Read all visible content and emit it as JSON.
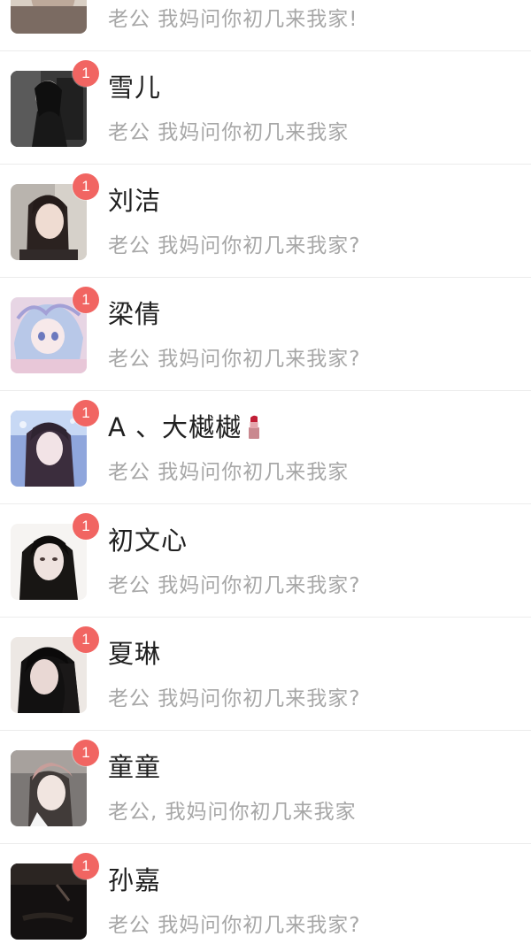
{
  "chats": [
    {
      "name": "",
      "message": "老公 我妈问你初几来我家!",
      "badge": "",
      "avatar": "avatar-partial"
    },
    {
      "name": "雪儿",
      "message": "老公 我妈问你初几来我家",
      "badge": "1",
      "avatar": "avatar-girl-dark"
    },
    {
      "name": "刘洁",
      "message": "老公 我妈问你初几来我家?",
      "badge": "1",
      "avatar": "avatar-girl-portrait"
    },
    {
      "name": "梁倩",
      "message": "老公 我妈问你初几来我家?",
      "badge": "1",
      "avatar": "avatar-anime"
    },
    {
      "name": "A 、大樾樾",
      "message": "老公 我妈问你初几来我家",
      "badge": "1",
      "avatar": "avatar-girl-blue",
      "name_icon": "lipstick-icon"
    },
    {
      "name": "初文心",
      "message": "老公 我妈问你初几来我家?",
      "badge": "1",
      "avatar": "avatar-girl-long-hair"
    },
    {
      "name": "夏琳",
      "message": "老公 我妈问你初几来我家?",
      "badge": "1",
      "avatar": "avatar-girl-black-hair"
    },
    {
      "name": "童童",
      "message": "老公, 我妈问你初几来我家",
      "badge": "1",
      "avatar": "avatar-girl-hat"
    },
    {
      "name": "孙嘉",
      "message": "老公 我妈问你初几来我家?",
      "badge": "1",
      "avatar": "avatar-dark-photo"
    }
  ],
  "colors": {
    "badge": "#f16562",
    "name": "#202020",
    "message": "#a7a7a7",
    "divider": "#ececec"
  }
}
